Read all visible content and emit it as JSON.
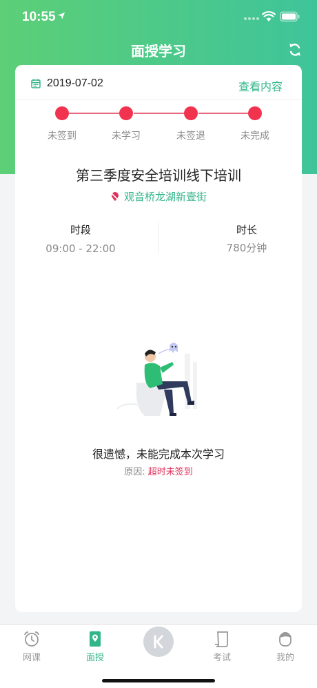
{
  "status_bar": {
    "time": "10:55"
  },
  "nav": {
    "title": "面授学习"
  },
  "card": {
    "date": "2019-07-02",
    "view_content": "查看内容",
    "steps": [
      {
        "label": "未签到"
      },
      {
        "label": "未学习"
      },
      {
        "label": "未签退"
      },
      {
        "label": "未完成"
      }
    ],
    "course_title": "第三季度安全培训线下培训",
    "location": "观音桥龙湖新壹街",
    "period_label": "时段",
    "period_value": "09:00 - 22:00",
    "duration_label": "时长",
    "duration_value": "780分钟",
    "fail_title": "很遗憾，未能完成本次学习",
    "reason_label": "原因:",
    "reason_value": "超时未签到"
  },
  "tabbar": {
    "items": [
      {
        "label": "网课"
      },
      {
        "label": "面授"
      },
      {
        "label": "考试"
      },
      {
        "label": "我的"
      }
    ]
  },
  "colors": {
    "accent": "#31b58a",
    "header": "#4ec78a",
    "step": "#f2334f",
    "reason": "#e0305a"
  }
}
